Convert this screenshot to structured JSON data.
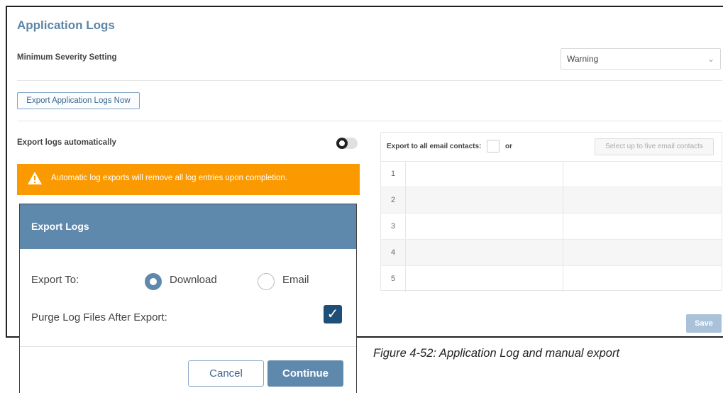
{
  "app": {
    "title": "Application Logs",
    "severity_label": "Minimum Severity Setting",
    "severity_value": "Warning",
    "export_now_label": "Export Application Logs Now",
    "auto_export_label": "Export logs automatically",
    "auto_export_enabled": false,
    "warning_text": "Automatic log exports will remove all log entries upon completion.",
    "warning_color": "#fb9a00",
    "save_label": "Save"
  },
  "email_contacts": {
    "all_label": "Export to all email contacts:",
    "or_label": "or",
    "select_label": "Select up to five email contacts",
    "rows": [
      "1",
      "2",
      "3",
      "4",
      "5"
    ]
  },
  "modal": {
    "title": "Export Logs",
    "export_to_label": "Export To:",
    "options": [
      "Download",
      "Email"
    ],
    "selected_option": "Download",
    "purge_label": "Purge Log Files After Export:",
    "purge_checked": true,
    "cancel_label": "Cancel",
    "continue_label": "Continue",
    "accent_color": "#5f88ad"
  },
  "caption": "Figure 4-52: Application Log and manual export"
}
